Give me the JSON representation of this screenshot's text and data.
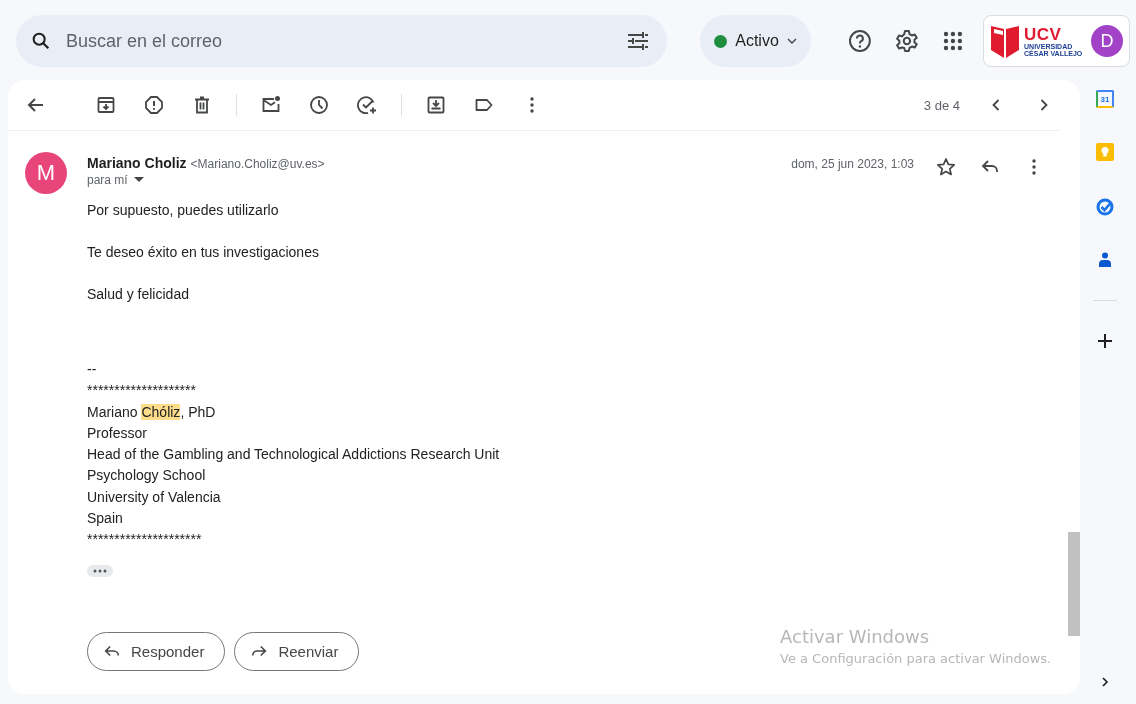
{
  "search": {
    "placeholder": "Buscar en el correo"
  },
  "status": {
    "label": "Activo"
  },
  "logo": {
    "acronym": "UCV",
    "line_1": "UNIVERSIDAD",
    "line_2": "CÉSAR VALLEJO"
  },
  "account": {
    "initial": "D"
  },
  "pager": {
    "position": "3 de 4"
  },
  "message": {
    "sender_initial": "M",
    "sender_name": "Mariano Choliz",
    "sender_email": "<Mariano.Choliz@uv.es>",
    "recipient": "para mí",
    "date": "dom, 25 jun 2023, 1:03",
    "starred": false,
    "paragraphs": [
      "Por supuesto, puedes utilizarlo",
      "Te deseo éxito en tus investigaciones",
      "Salud y felicidad"
    ],
    "signature": [
      {
        "text": "--"
      },
      {
        "text": "********************"
      },
      {
        "text": "Mariano ",
        "highlight": "Chóliz",
        "after": ", PhD"
      },
      {
        "text": "Professor"
      },
      {
        "text": "Head of the Gambling and Technological Addictions Research Unit"
      },
      {
        "text": "Psychology School"
      },
      {
        "text": "University of Valencia"
      },
      {
        "text": "Spain"
      },
      {
        "text": "*********************"
      }
    ]
  },
  "actions": [
    {
      "kind": "reply",
      "label": "Responder"
    },
    {
      "kind": "forward",
      "label": "Reenviar"
    }
  ],
  "side_panel": {
    "calendar_day": "31"
  },
  "os_notice": {
    "title": "Activar Windows",
    "text": "Ve a Configuración para activar Windows."
  }
}
